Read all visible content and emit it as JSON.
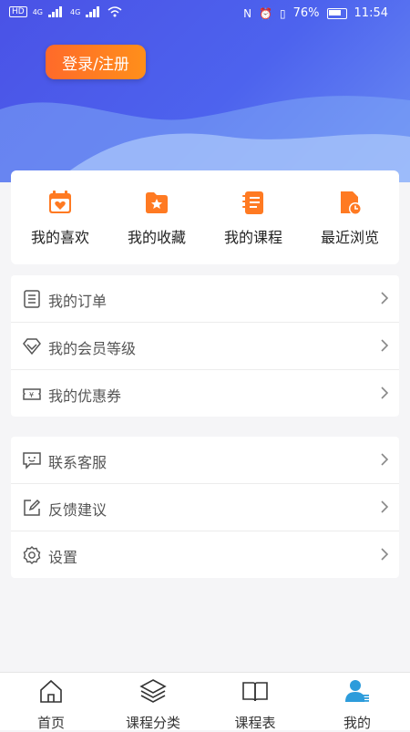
{
  "status_bar": {
    "carrier_left": "HD",
    "battery_pct": "76%",
    "time": "11:54",
    "net1": "4G",
    "net2": "4G"
  },
  "header": {
    "login_label": "登录/注册"
  },
  "quick_actions": [
    {
      "label": "我的喜欢",
      "icon": "heart-calendar-icon"
    },
    {
      "label": "我的收藏",
      "icon": "star-folder-icon"
    },
    {
      "label": "我的课程",
      "icon": "notebook-icon"
    },
    {
      "label": "最近浏览",
      "icon": "recent-clock-icon"
    }
  ],
  "menu_group_1": [
    {
      "label": "我的订单",
      "icon": "order-list-icon"
    },
    {
      "label": "我的会员等级",
      "icon": "diamond-icon"
    },
    {
      "label": "我的优惠券",
      "icon": "coupon-icon"
    }
  ],
  "menu_group_2": [
    {
      "label": "联系客服",
      "icon": "chat-icon"
    },
    {
      "label": "反馈建议",
      "icon": "edit-icon"
    },
    {
      "label": "设置",
      "icon": "gear-icon"
    }
  ],
  "tab_bar": [
    {
      "label": "首页",
      "icon": "home-icon"
    },
    {
      "label": "课程分类",
      "icon": "layers-icon"
    },
    {
      "label": "课程表",
      "icon": "book-icon"
    },
    {
      "label": "我的",
      "icon": "user-icon",
      "active": true
    }
  ],
  "colors": {
    "hero": "#4d63ee",
    "accent_orange": "#ff7a22",
    "active_tab": "#2d9cdb"
  }
}
